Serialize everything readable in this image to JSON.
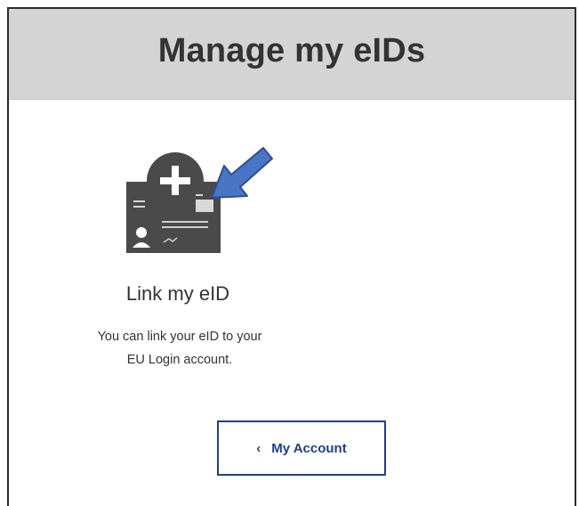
{
  "header": {
    "title": "Manage my eIDs"
  },
  "link_eid": {
    "icon": "eid-card-add-icon",
    "pointer_icon": "blue-arrow-icon",
    "title": "Link my eID",
    "description_line1": "You can link your eID to your",
    "description_line2": "EU Login account."
  },
  "account_button": {
    "chevron": "‹",
    "label": "My Account"
  },
  "colors": {
    "header_bg": "#d4d4d4",
    "icon_gray": "#4a4a4a",
    "arrow_blue": "#4a74c4",
    "button_border": "#1f3f8a"
  }
}
